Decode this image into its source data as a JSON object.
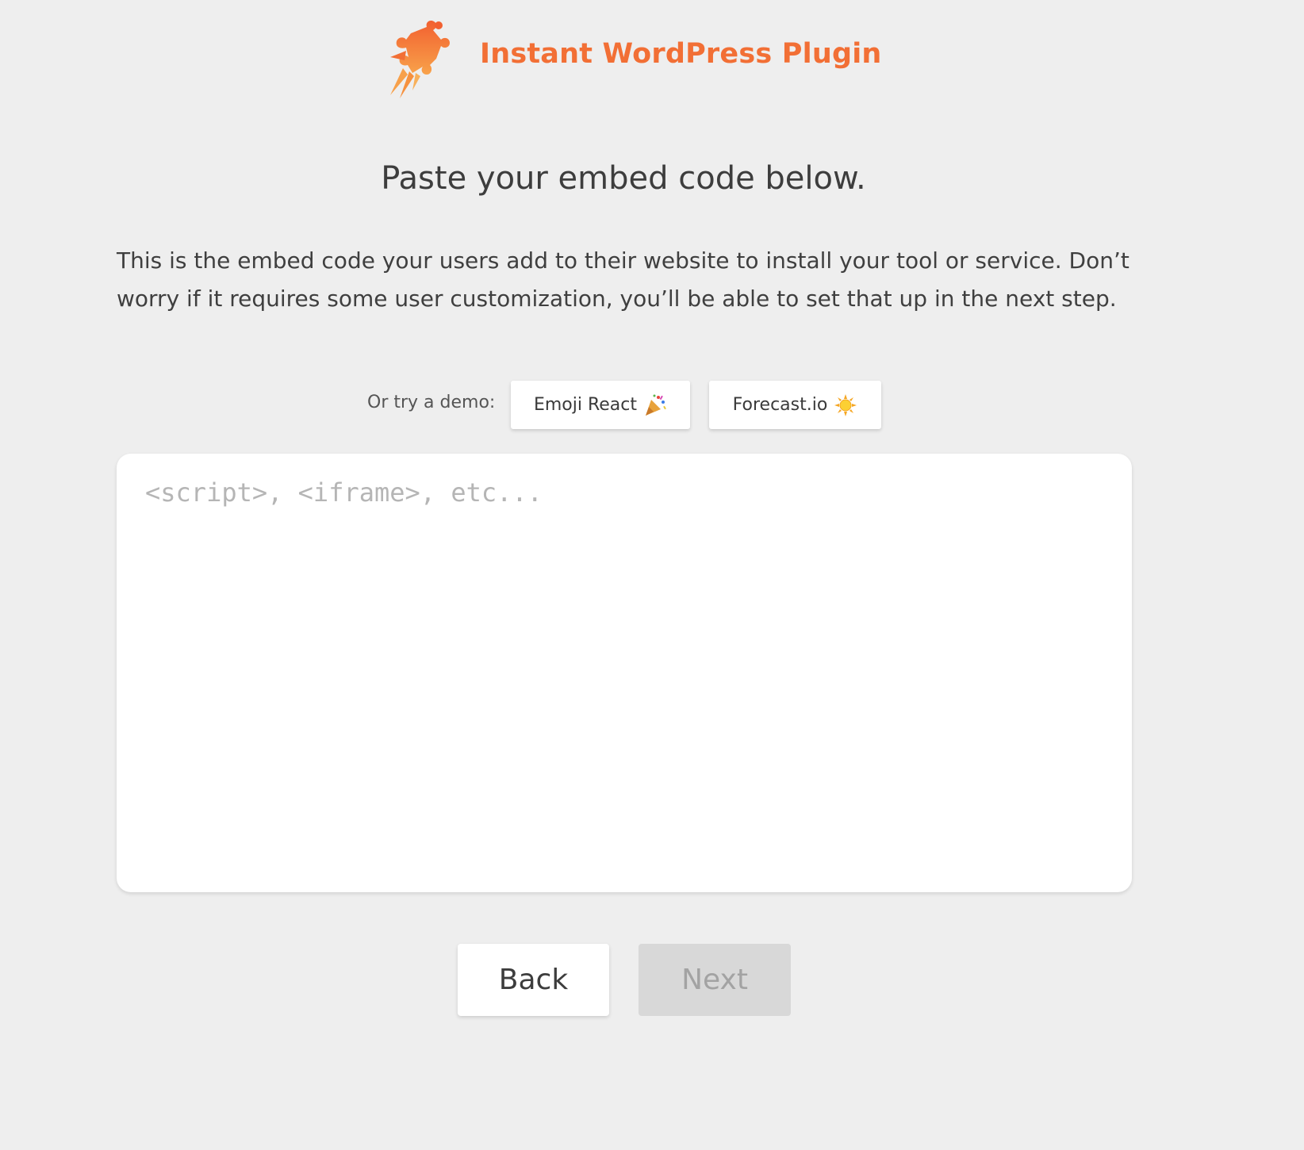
{
  "header": {
    "logo_icon": "puzzle-rocket-icon",
    "title": "Instant WordPress Plugin",
    "brand_color": "#f26f35"
  },
  "main": {
    "heading": "Paste your embed code below.",
    "description": "This is the embed code your users add to their website to install your tool or service. Don’t worry if it requires some user customization, you’ll be able to set that up in the next step."
  },
  "demo": {
    "label": "Or try a demo:",
    "buttons": [
      {
        "label": "Emoji React",
        "icon": "party-popper-icon"
      },
      {
        "label": "Forecast.io",
        "icon": "sun-icon"
      }
    ]
  },
  "embed_input": {
    "value": "",
    "placeholder": "<script>, <iframe>, etc..."
  },
  "footer": {
    "back_label": "Back",
    "next_label": "Next",
    "next_disabled": true
  }
}
